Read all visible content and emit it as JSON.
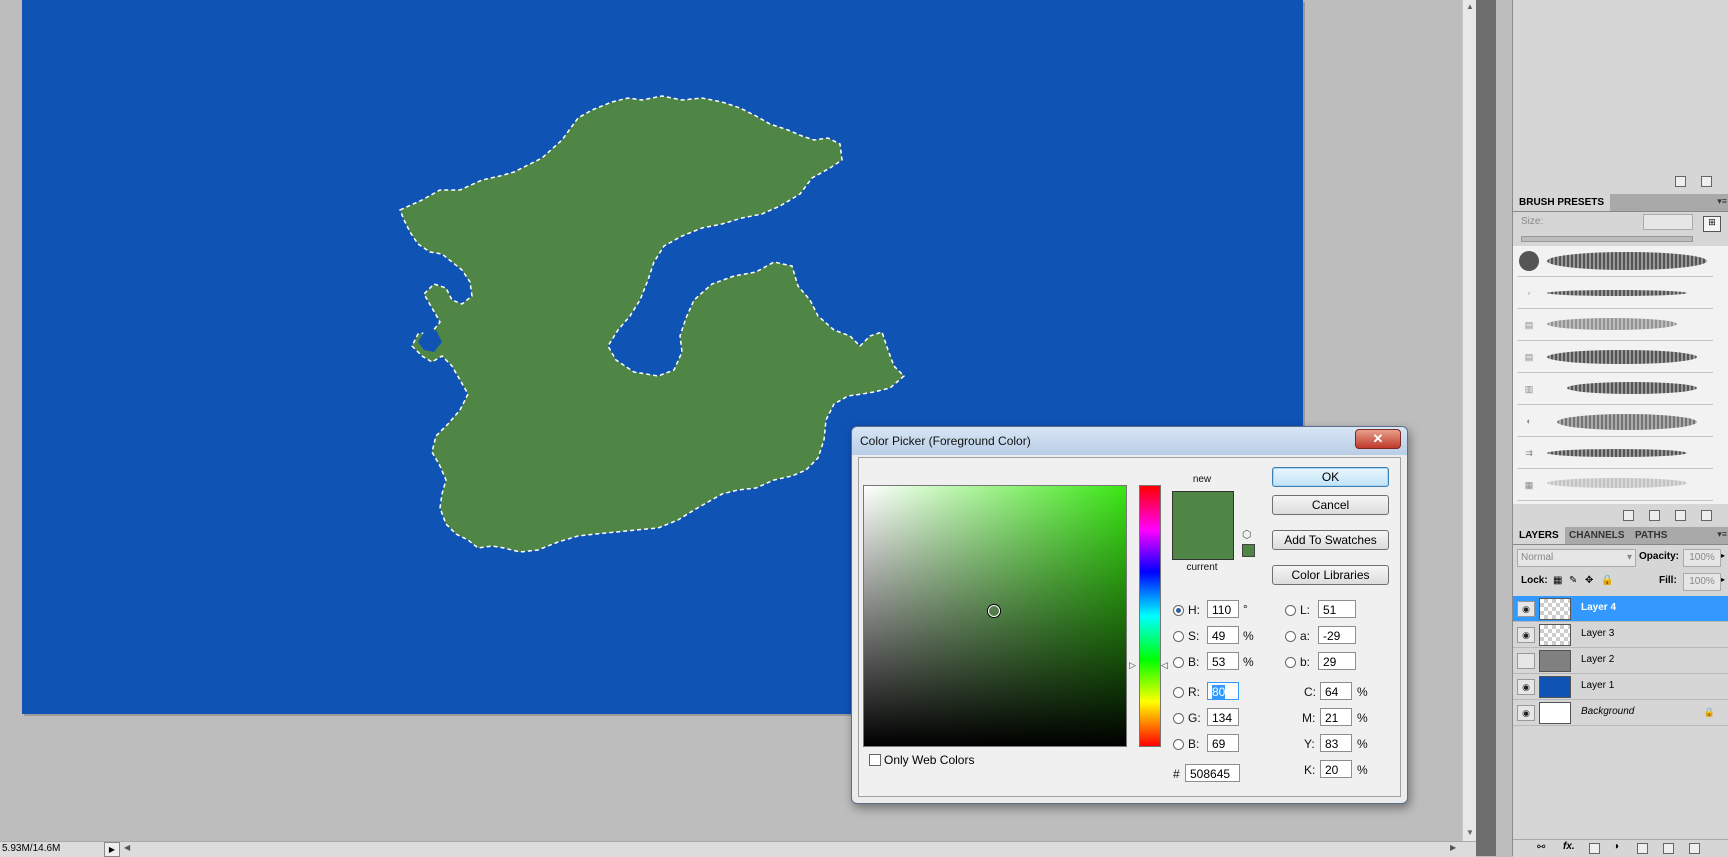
{
  "status": {
    "doc_size": "5.93M/14.6M"
  },
  "brush_presets": {
    "tab": "BRUSH PRESETS",
    "size_label": "Size:"
  },
  "layers_panel": {
    "tabs": [
      "LAYERS",
      "CHANNELS",
      "PATHS"
    ],
    "blend_mode": "Normal",
    "opacity_label": "Opacity:",
    "opacity_value": "100%",
    "lock_label": "Lock:",
    "fill_label": "Fill:",
    "fill_value": "100%",
    "layers": [
      {
        "name": "Layer 4",
        "selected": true,
        "visible": true
      },
      {
        "name": "Layer 3",
        "selected": false,
        "visible": true
      },
      {
        "name": "Layer 2",
        "selected": false,
        "visible": false
      },
      {
        "name": "Layer 1",
        "selected": false,
        "visible": true
      },
      {
        "name": "Background",
        "selected": false,
        "visible": true
      }
    ]
  },
  "dialog": {
    "title": "Color Picker (Foreground Color)",
    "close": "✕",
    "new_label": "new",
    "current_label": "current",
    "buttons": {
      "ok": "OK",
      "cancel": "Cancel",
      "add_swatches": "Add To Swatches",
      "libraries": "Color Libraries"
    },
    "hsb": {
      "h_label": "H:",
      "h": "110",
      "h_unit": "°",
      "s_label": "S:",
      "s": "49",
      "s_unit": "%",
      "b_label": "B:",
      "b": "53",
      "b_unit": "%"
    },
    "rgb": {
      "r_label": "R:",
      "r": "80",
      "g_label": "G:",
      "g": "134",
      "b_label": "B:",
      "b": "69"
    },
    "lab": {
      "l_label": "L:",
      "l": "51",
      "a_label": "a:",
      "a": "-29",
      "b_label": "b:",
      "b": "29"
    },
    "cmyk": {
      "c_label": "C:",
      "c": "64",
      "m_label": "M:",
      "m": "21",
      "y_label": "Y:",
      "y": "83",
      "k_label": "K:",
      "k": "20",
      "unit": "%"
    },
    "hex_label": "#",
    "hex": "508645",
    "web_colors_label": "Only Web Colors"
  },
  "colors": {
    "canvas_blue": "#0f53b5",
    "land_green": "#508645",
    "selection_blue": "#3399ff"
  }
}
